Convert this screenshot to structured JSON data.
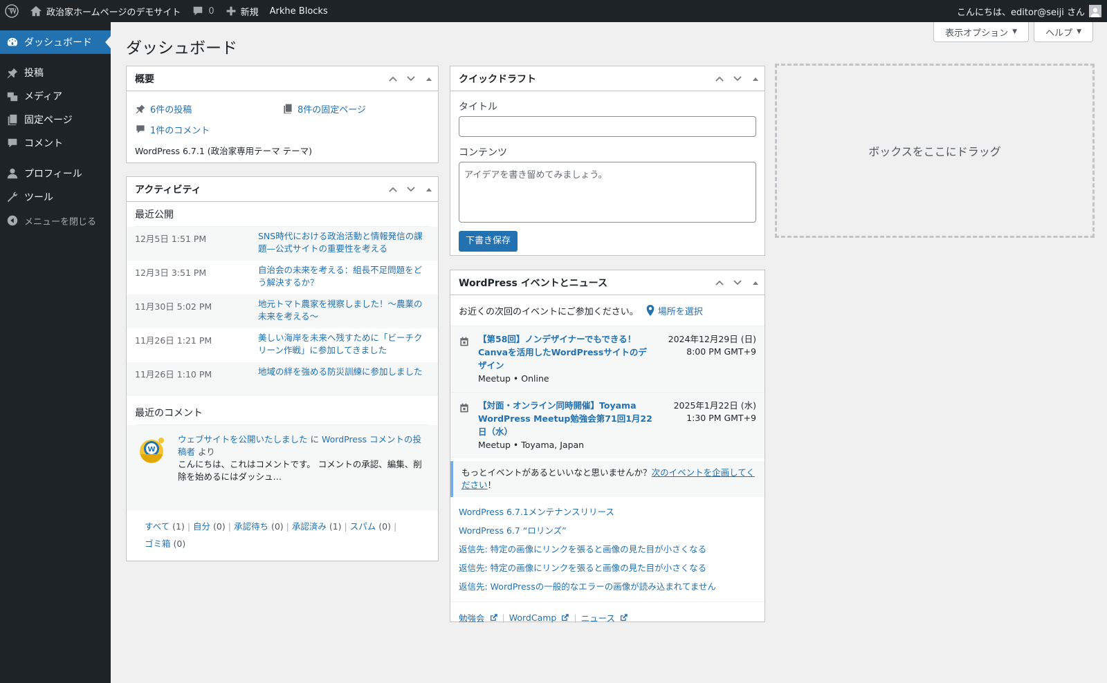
{
  "adminbar": {
    "site_name": "政治家ホームページのデモサイト",
    "comments_count": "0",
    "new_label": "新規",
    "theme_item": "Arkhe Blocks",
    "greeting": "こんにちは、editor@seiji さん"
  },
  "sidebar": {
    "items": [
      {
        "label": "ダッシュボード",
        "icon": "dashboard-icon",
        "current": true
      },
      {
        "label": "投稿",
        "icon": "pin-icon"
      },
      {
        "label": "メディア",
        "icon": "media-icon"
      },
      {
        "label": "固定ページ",
        "icon": "page-icon"
      },
      {
        "label": "コメント",
        "icon": "comment-icon"
      },
      {
        "label": "プロフィール",
        "icon": "user-icon"
      },
      {
        "label": "ツール",
        "icon": "wrench-icon"
      },
      {
        "label": "メニューを閉じる",
        "icon": "collapse-icon"
      }
    ]
  },
  "screen_meta": {
    "options": "表示オプション",
    "help": "ヘルプ"
  },
  "page_title": "ダッシュボード",
  "glance": {
    "title": "概要",
    "posts": "6件の投稿",
    "pages": "8件の固定ページ",
    "comments": "1件のコメント",
    "version": "WordPress 6.7.1 (政治家専用テーマ テーマ)"
  },
  "activity": {
    "title": "アクティビティ",
    "recent_heading": "最近公開",
    "posts": [
      {
        "date": "12月5日 1:51 PM",
        "title": "SNS時代における政治活動と情報発信の課題—公式サイトの重要性を考える"
      },
      {
        "date": "12月3日 3:51 PM",
        "title": "自治会の未来を考える：組長不足問題をどう解決するか？"
      },
      {
        "date": "11月30日 5:02 PM",
        "title": "地元トマト農家を視察しました！〜農業の未来を考える〜"
      },
      {
        "date": "11月26日 1:21 PM",
        "title": "美しい海岸を未来へ残すために「ビーチクリーン作戦」に参加してきました"
      },
      {
        "date": "11月26日 1:10 PM",
        "title": "地域の絆を強める防災訓練に参加しました"
      }
    ],
    "comments_heading": "最近のコメント",
    "comment": {
      "post_link": "ウェブサイトを公開いたしました",
      "on": "に",
      "author": "WordPress コメントの投稿者",
      "by": "より",
      "excerpt": "こんにちは、これはコメントです。 コメントの承認、編集、削除を始めるにはダッシュ…"
    },
    "filters": [
      {
        "label": "すべて",
        "count": "(1)"
      },
      {
        "label": "自分",
        "count": "(0)"
      },
      {
        "label": "承認待ち",
        "count": "(0)"
      },
      {
        "label": "承認済み",
        "count": "(1)"
      },
      {
        "label": "スパム",
        "count": "(0)"
      },
      {
        "label": "ゴミ箱",
        "count": "(0)"
      }
    ]
  },
  "quickdraft": {
    "title": "クイックドラフト",
    "title_label": "タイトル",
    "content_label": "コンテンツ",
    "content_placeholder": "アイデアを書き留めてみましょう。",
    "save": "下書き保存"
  },
  "events": {
    "title": "WordPress イベントとニュース",
    "intro": "お近くの次回のイベントにご参加ください。",
    "location": "場所を選択",
    "items": [
      {
        "title": "【第58回】ノンデザイナーでもできる！ Canvaを活用したWordPressサイトのデザイン",
        "meta": "Meetup • Online",
        "date": "2024年12月29日 (日)",
        "time": "8:00 PM GMT+9"
      },
      {
        "title": "【対面・オンライン同時開催】Toyama WordPress Meetup勉強会第71回1月22日（水）",
        "meta": "Meetup • Toyama, Japan",
        "date": "2025年1月22日 (水)",
        "time": "1:30 PM GMT+9"
      }
    ],
    "notice_text": "もっとイベントがあるといいなと思いませんか？",
    "notice_link": "次のイベントを企画してください",
    "notice_end": "！",
    "news": [
      "WordPress 6.7.1メンテナンスリリース",
      "WordPress 6.7 “ロリンズ”",
      "返信先: 特定の画像にリンクを張ると画像の見た目が小さくなる",
      "返信先: 特定の画像にリンクを張ると画像の見た目が小さくなる",
      "返信先: WordPressの一般的なエラーの画像が読み込まれてません"
    ],
    "footer": [
      "勉強会",
      "WordCamp",
      "ニュース"
    ]
  },
  "drop_zone": "ボックスをここにドラッグ",
  "colors": {
    "accent": "#2271b1",
    "adminbar": "#1d2327",
    "background": "#f0f0f1"
  }
}
